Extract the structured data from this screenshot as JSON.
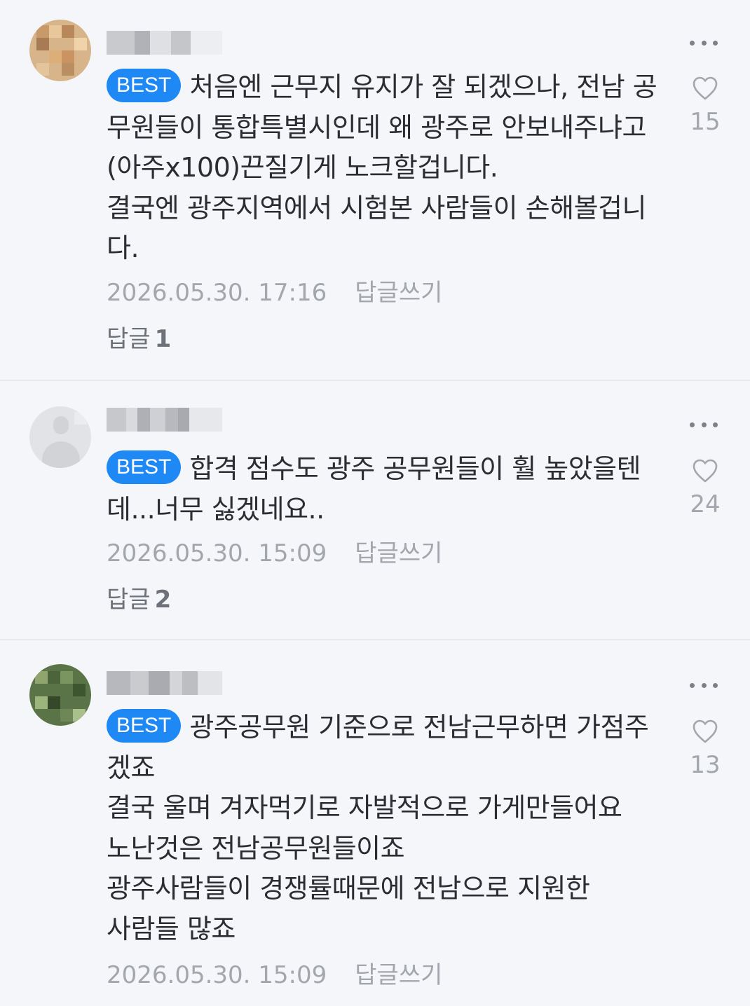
{
  "comments": [
    {
      "badge": "BEST",
      "text": "처음엔 근무지 유지가 잘 되겠으나, 전남 공\n무원들이 통합특별시인데 왜 광주로 안보내주냐고\n(아주x100)끈질기게 노크할겁니다.\n결국엔 광주지역에서 시험본 사람들이 손해볼겁니\n다.",
      "timestamp": "2026.05.30. 17:16",
      "reply_write_label": "답글쓰기",
      "reply_label": "답글",
      "reply_count": "1",
      "like_count": "15",
      "more_icon": "more-dots-icon",
      "like_icon": "heart-outline-icon"
    },
    {
      "badge": "BEST",
      "text": "합격 점수도 광주 공무원들이 훨 높았을텐\n데...너무 싫겠네요..",
      "timestamp": "2026.05.30. 15:09",
      "reply_write_label": "답글쓰기",
      "reply_label": "답글",
      "reply_count": "2",
      "like_count": "24",
      "more_icon": "more-dots-icon",
      "like_icon": "heart-outline-icon"
    },
    {
      "badge": "BEST",
      "text": "광주공무원 기준으로 전남근무하면 가점주\n겠죠\n결국 울며 겨자먹기로 자발적으로 가게만들어요\n노난것은 전남공무원들이죠\n광주사람들이 경쟁률때문에 전남으로 지원한\n사람들 많죠",
      "timestamp": "2026.05.30. 15:09",
      "reply_write_label": "답글쓰기",
      "like_count": "13",
      "more_icon": "more-dots-icon",
      "like_icon": "heart-outline-icon"
    }
  ],
  "colors": {
    "background": "#f5f6f9",
    "best_badge": "#1e88f5",
    "body_text": "#2b2d33",
    "meta_text": "#a3a6ad",
    "divider": "#e9eaee"
  }
}
